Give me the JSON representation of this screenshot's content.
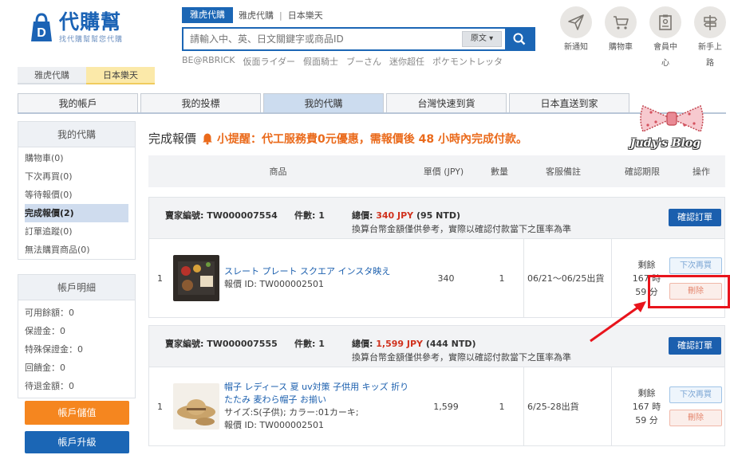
{
  "header": {
    "logo_title": "代購幫",
    "logo_subtitle": "找代購幫幫您代購",
    "site_tabs": [
      "雅虎代購",
      "日本樂天"
    ],
    "active_site_tab_index": 1
  },
  "search": {
    "tabs": [
      "雅虎代購",
      "雅虎代購",
      "日本樂天"
    ],
    "separator": "|",
    "placeholder": "請輸入中、英、日文關鍵字或商品ID",
    "lang_select": "原文",
    "hot_keywords": [
      "BE@RBRICK",
      "仮面ライダー",
      "假面騎士",
      "ブーさん",
      "迷你超任",
      "ポケモントレッタ"
    ]
  },
  "top_icons": [
    {
      "label": "新通知",
      "icon": "send-icon"
    },
    {
      "label": "購物車",
      "icon": "cart-icon"
    },
    {
      "label": "會員中心",
      "icon": "member-icon"
    },
    {
      "label": "新手上路",
      "icon": "signpost-icon"
    }
  ],
  "main_nav": [
    "我的帳戶",
    "我的投標",
    "我的代購",
    "台灣快速到貨",
    "日本直送到家"
  ],
  "main_nav_active_index": 2,
  "watermark": "Judy's Blog",
  "sidebar": {
    "my_purchase_title": "我的代購",
    "items": [
      "購物車(0)",
      "下次再買(0)",
      "等待報價(0)",
      "完成報價(2)",
      "訂單追蹤(0)",
      "無法購買商品(0)"
    ],
    "active_index": 3,
    "account_title": "帳戶明細",
    "account_lines": [
      "可用餘額：0",
      "保證金：0",
      "特殊保證金：0",
      "回饋金：0",
      "待退金額：0"
    ],
    "topup_button": "帳戶儲值",
    "upgrade_button": "帳戶升級"
  },
  "content": {
    "title": "完成報價",
    "notice": "小提醒：代工服務費0元優惠，需報價後 48 小時內完成付款。"
  },
  "table_headers": {
    "product": "商品",
    "unit_price": "單價 (JPY)",
    "qty": "數量",
    "remark": "客服備註",
    "deadline": "確認期限",
    "action": "操作"
  },
  "orders": [
    {
      "seller_label": "賣家編號: TW000007554",
      "count_label": "件數: 1",
      "total_prefix": "總價: ",
      "total_jpy": "340 JPY",
      "total_ntd": " (95 NTD)",
      "note": "換算台幣金額僅供參考，實際以確認付款當下之匯率為準",
      "confirm_button": "確認訂單",
      "item": {
        "index": "1",
        "name": "スレート プレート スクエア インスタ映え",
        "quote_id": "報價 ID: TW000002501",
        "price": "340",
        "qty": "1",
        "remark": "06/21～06/25出貨",
        "deadline": [
          "剩餘",
          "167 時",
          "59 分"
        ],
        "next_button": "下次再買",
        "delete_button": "刪除"
      }
    },
    {
      "seller_label": "賣家編號: TW000007555",
      "count_label": "件數: 1",
      "total_prefix": "總價: ",
      "total_jpy": "1,599 JPY",
      "total_ntd": " (444 NTD)",
      "note": "換算台幣金額僅供參考，實際以確認付款當下之匯率為準",
      "confirm_button": "確認訂單",
      "item": {
        "index": "1",
        "name": "帽子 レディース 夏 uv対策 子供用 キッズ 折りたたみ 麦わら帽子 お揃い",
        "spec": "サイズ:S(子供); カラー:01カーキ;",
        "quote_id": "報價 ID: TW000002501",
        "price": "1,599",
        "qty": "1",
        "remark": "6/25-28出貨",
        "deadline": [
          "剩餘",
          "167 時",
          "59 分"
        ],
        "next_button": "下次再買",
        "delete_button": "刪除"
      }
    }
  ],
  "colors": {
    "brand_blue": "#1b66b5",
    "notice_orange": "#ea6a1b",
    "price_red": "#d0321e",
    "highlight_red": "#e8141c"
  }
}
